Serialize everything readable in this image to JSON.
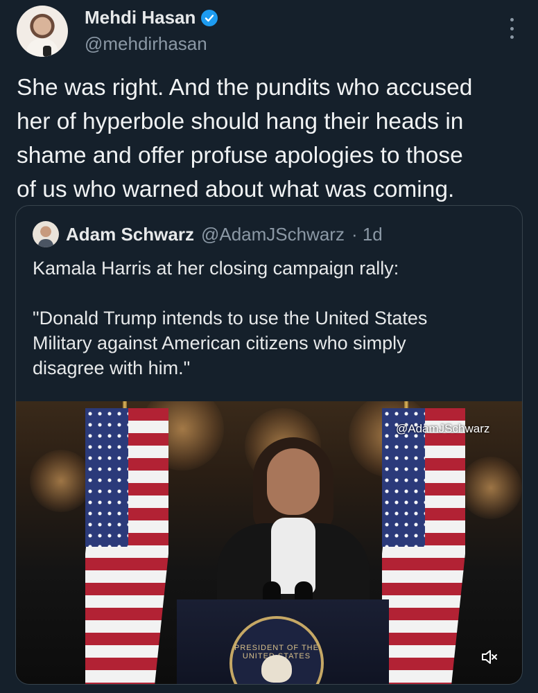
{
  "author": {
    "display_name": "Mehdi Hasan",
    "handle": "@mehdirhasan",
    "verified": true
  },
  "tweet": {
    "text": "She was right. And the pundits who accused\nher of hyperbole should hang their heads in\nshame and offer profuse apologies to those\nof us who warned about what was coming."
  },
  "quoted": {
    "display_name": "Adam Schwarz",
    "handle": "@AdamJSchwarz",
    "time": "· 1d",
    "text": "Kamala Harris at her closing campaign rally:\n\n\"Donald Trump intends to use the United States\nMilitary against American citizens who simply\ndisagree with him.\"",
    "media": {
      "watermark": "@AdamJSchwarz",
      "seal_text": "PRESIDENT OF THE UNITED STATES",
      "muted": true
    }
  },
  "icons": {
    "verified": "verified-badge-icon",
    "more": "more-options-icon",
    "mute": "speaker-muted-icon"
  },
  "colors": {
    "background": "#15202b",
    "text": "#e7e9ea",
    "secondary_text": "#8b98a5",
    "verified_blue": "#1d9bf0",
    "border": "#38444d"
  }
}
